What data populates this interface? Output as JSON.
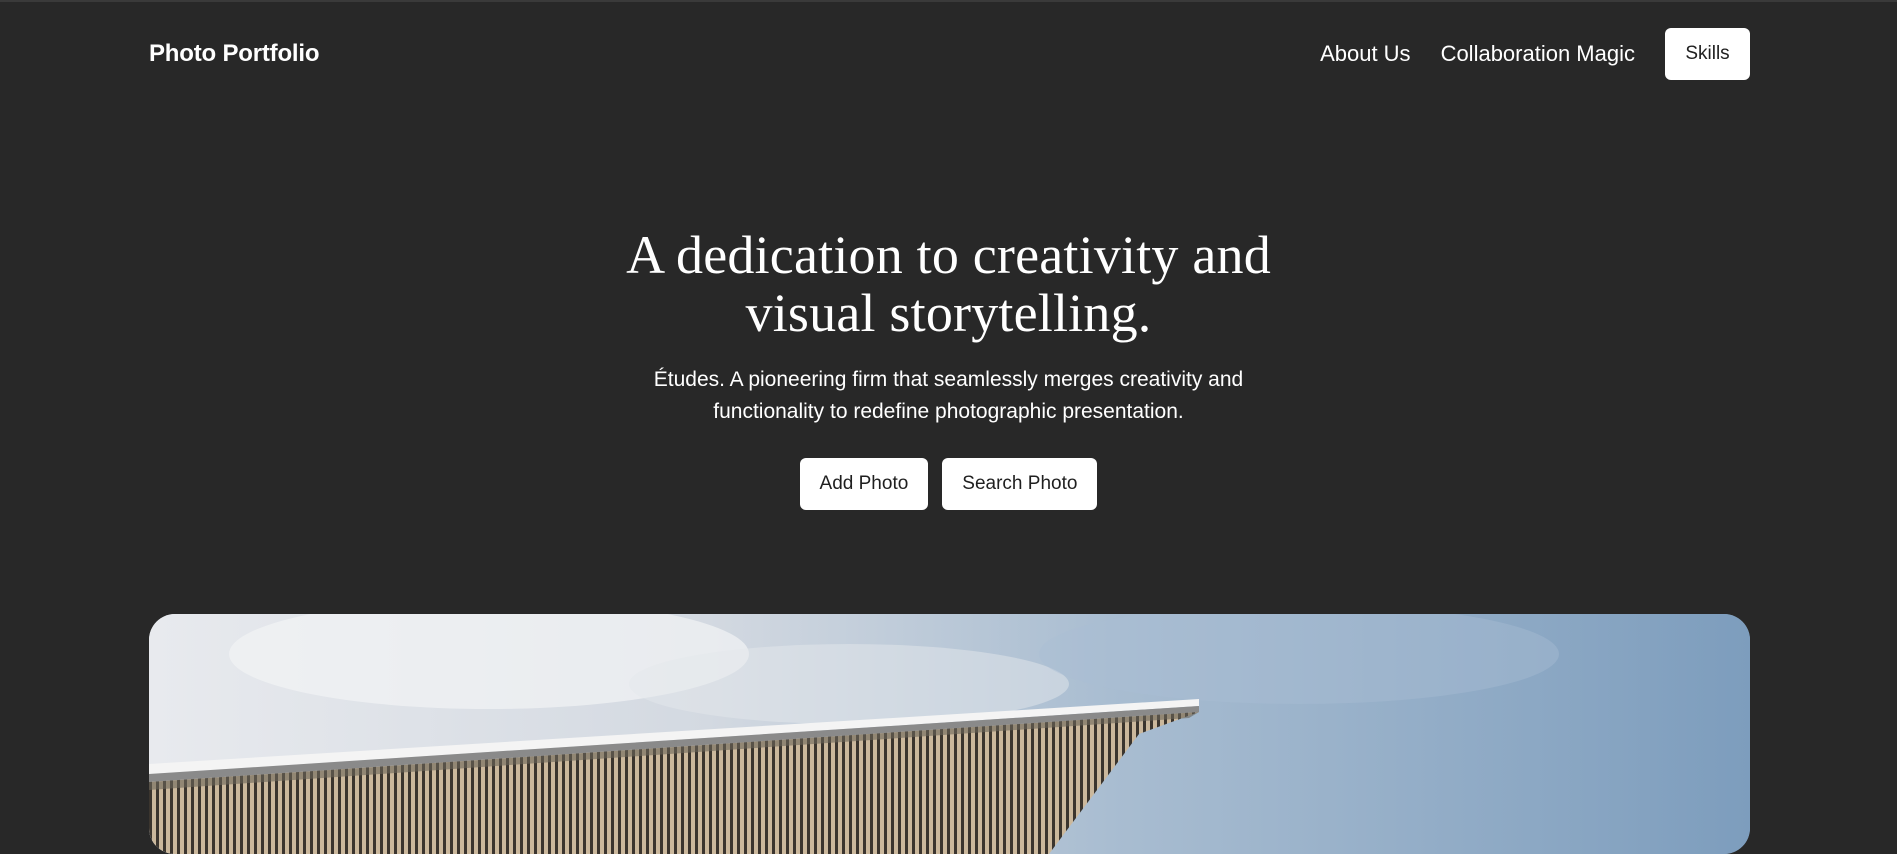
{
  "header": {
    "brand": "Photo Portfolio",
    "nav": {
      "about": "About Us",
      "collaboration": "Collaboration Magic",
      "skills": "Skills"
    }
  },
  "hero": {
    "title": "A dedication to creativity and visual storytelling.",
    "subtitle": "Études. A pioneering firm that seamlessly merges creativity and functionality to redefine photographic presentation.",
    "actions": {
      "add": "Add Photo",
      "search": "Search Photo"
    }
  },
  "colors": {
    "background": "#282828",
    "button": "#ffffff",
    "text": "#ffffff"
  }
}
